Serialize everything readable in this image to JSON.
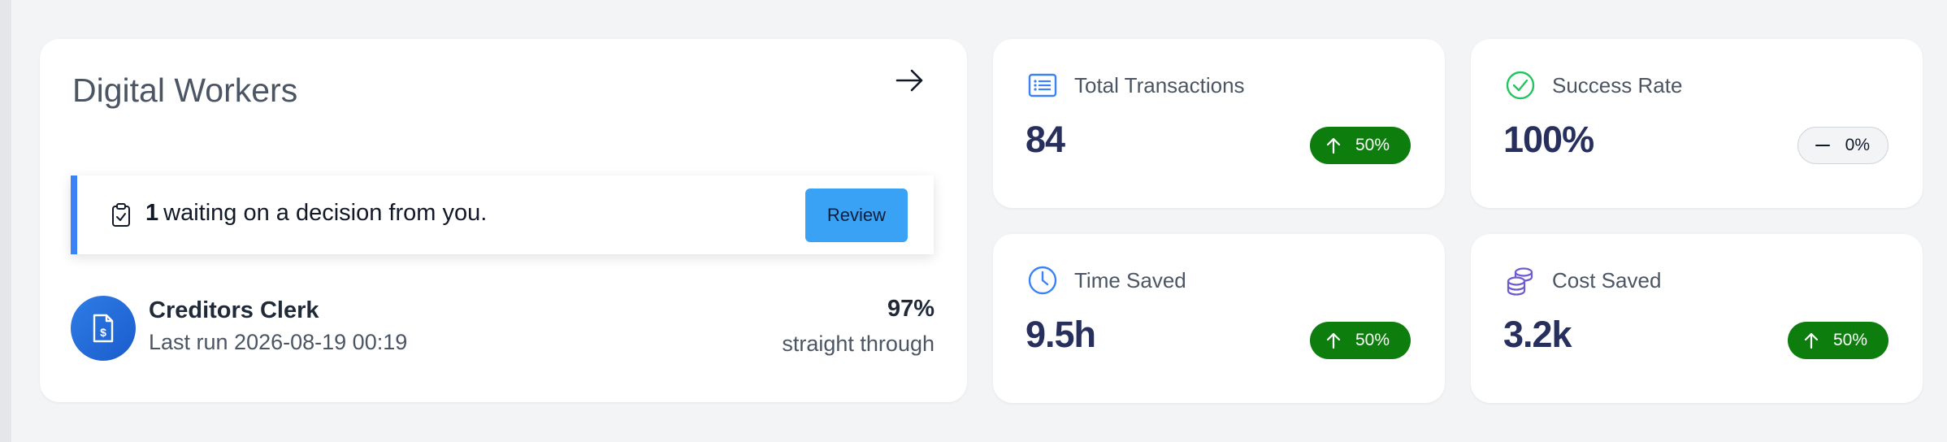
{
  "digital_workers": {
    "title": "Digital Workers",
    "alert": {
      "count": "1",
      "message": "waiting on a decision from you.",
      "button_label": "Review"
    },
    "worker": {
      "name": "Creditors Clerk",
      "last_run": "Last run 2026-08-19 00:19",
      "percent": "97%",
      "percent_label": "straight through"
    }
  },
  "metrics": [
    {
      "label": "Total Transactions",
      "value": "84",
      "change": "50%",
      "trend": "up",
      "icon": "list-icon",
      "icon_color": "#3b82f6"
    },
    {
      "label": "Success Rate",
      "value": "100%",
      "change": "0%",
      "trend": "flat",
      "icon": "check-circle-icon",
      "icon_color": "#22c55e"
    },
    {
      "label": "Time Saved",
      "value": "9.5h",
      "change": "50%",
      "trend": "up",
      "icon": "clock-icon",
      "icon_color": "#3b82f6"
    },
    {
      "label": "Cost Saved",
      "value": "3.2k",
      "change": "50%",
      "trend": "up",
      "icon": "coins-icon",
      "icon_color": "#6d5bd0"
    }
  ],
  "colors": {
    "accent": "#3b82f6",
    "badge_green": "#0d7d0d",
    "value_text": "#272f5c"
  }
}
